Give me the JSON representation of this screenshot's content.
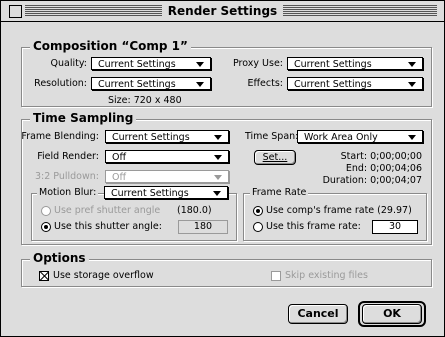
{
  "window": {
    "title": "Render Settings"
  },
  "composition": {
    "heading": "Composition “Comp 1”",
    "quality_label": "Quality:",
    "quality_value": "Current Settings",
    "resolution_label": "Resolution:",
    "resolution_value": "Current Settings",
    "size_text": "Size: 720 x 480",
    "proxy_label": "Proxy Use:",
    "proxy_value": "Current Settings",
    "effects_label": "Effects:",
    "effects_value": "Current Settings"
  },
  "time_sampling": {
    "heading": "Time Sampling",
    "frame_blending_label": "Frame Blending:",
    "frame_blending_value": "Current Settings",
    "field_render_label": "Field Render:",
    "field_render_value": "Off",
    "pulldown_label": "3:2 Pulldown:",
    "pulldown_value": "Off",
    "time_span_label": "Time Span:",
    "time_span_value": "Work Area Only",
    "set_button": "Set...",
    "start_text": "Start: 0;00;00;00",
    "end_text": "End: 0;00;04;06",
    "duration_text": "Duration: 0;00;04;07",
    "motion_blur_label": "Motion Blur:",
    "motion_blur_value": "Current Settings",
    "use_pref_shutter_label": "Use pref shutter angle",
    "pref_shutter_value": "(180.0)",
    "use_this_shutter_label": "Use this shutter angle:",
    "shutter_angle_value": "180",
    "frame_rate_heading": "Frame Rate",
    "use_comp_rate_label": "Use comp's frame rate (29.97)",
    "use_this_rate_label": "Use this frame rate:",
    "frame_rate_value": "30"
  },
  "options": {
    "heading": "Options",
    "storage_overflow_label": "Use storage overflow",
    "skip_existing_label": "Skip existing files"
  },
  "buttons": {
    "cancel": "Cancel",
    "ok": "OK"
  }
}
